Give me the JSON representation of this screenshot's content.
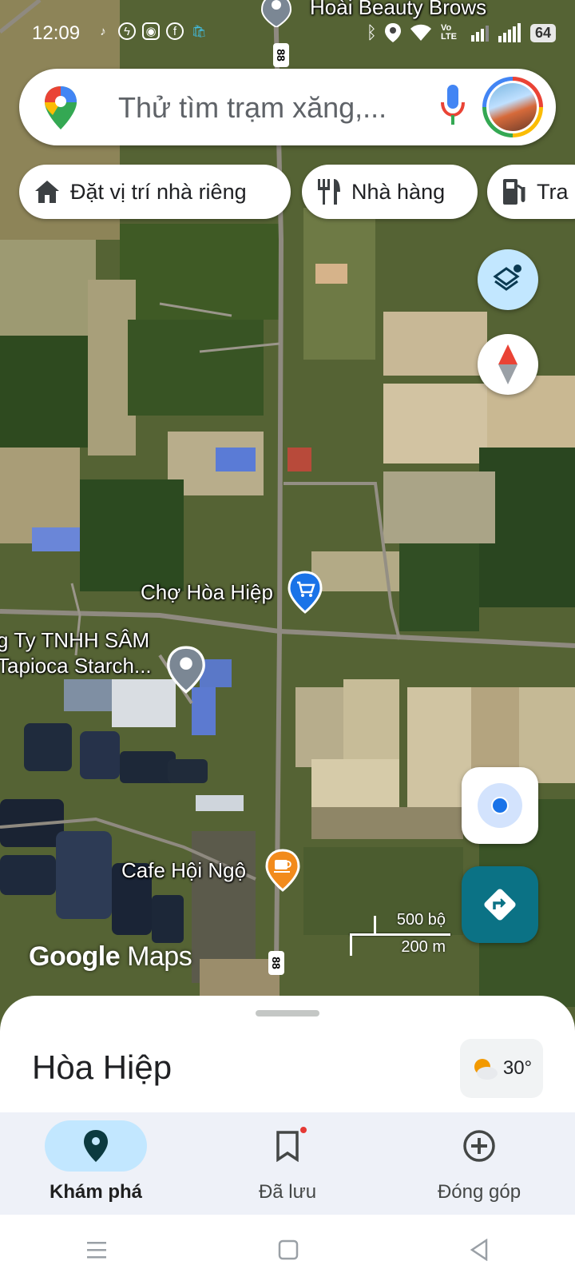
{
  "status_bar": {
    "time": "12:09",
    "carrier_text": "Vo LTE",
    "battery": "64",
    "app_icons": [
      "tiktok-icon",
      "messenger-icon",
      "instagram-icon",
      "facebook-icon",
      "shopping-icon"
    ]
  },
  "search": {
    "placeholder": "Thử tìm trạm xăng,..."
  },
  "chips": [
    {
      "label": "Đặt vị trí nhà riêng",
      "icon": "home-icon"
    },
    {
      "label": "Nhà hàng",
      "icon": "restaurant-icon"
    },
    {
      "label": "Tra",
      "icon": "gas-station-icon"
    }
  ],
  "map": {
    "top_label": "Hoài Beauty Brows",
    "route_shield_top": "88",
    "route_shield_bottom": "88",
    "market_label": "Chợ Hòa Hiệp",
    "company_label_1": "g Ty TNHH SÂM",
    "company_label_2": "Tapioca Starch...",
    "cafe_label": "Cafe Hội Ngộ",
    "watermark_google": "Google",
    "watermark_maps": "Maps",
    "scale_top": "500 bộ",
    "scale_bottom": "200 m",
    "colors": {
      "market_pin": "#1a73e8",
      "cafe_pin": "#f28b1c",
      "directions_fab": "#0b7285"
    }
  },
  "sheet": {
    "place_name": "Hòa Hiệp",
    "weather_temp": "30°"
  },
  "bottom_nav": [
    {
      "label": "Khám phá",
      "icon": "explore-pin-icon",
      "active": true
    },
    {
      "label": "Đã lưu",
      "icon": "bookmark-icon",
      "active": false
    },
    {
      "label": "Đóng góp",
      "icon": "add-circle-icon",
      "active": false
    }
  ]
}
